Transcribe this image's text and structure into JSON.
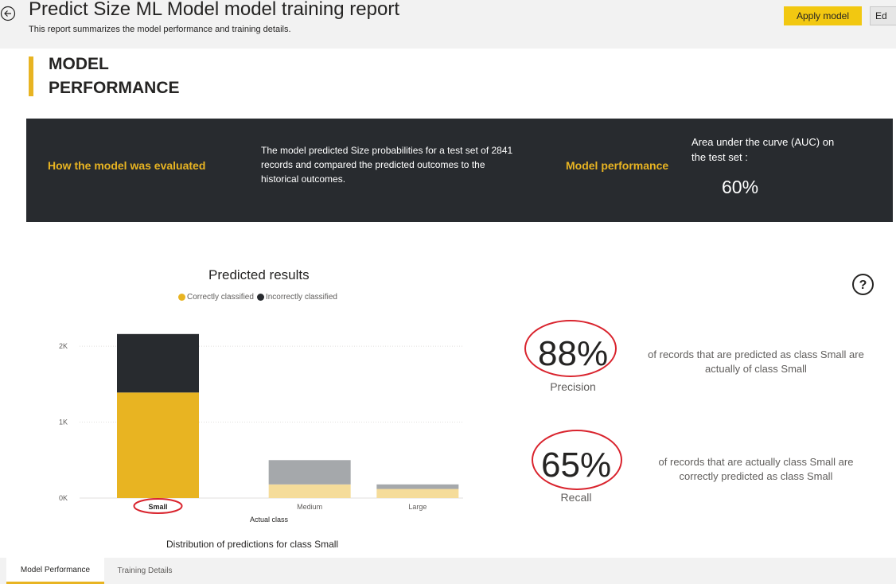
{
  "header": {
    "title": "Predict Size ML Model model training report",
    "subtitle": "This report summarizes the model performance and training details.",
    "apply_label": "Apply model",
    "edit_label": "Ed"
  },
  "section": {
    "title": "MODEL PERFORMANCE"
  },
  "evaluation": {
    "heading": "How the model was evaluated",
    "description": "The model predicted Size probabilities for a test set of 2841 records and compared the predicted outcomes to the historical outcomes.",
    "performance_heading": "Model performance",
    "auc_label": "Area under the curve (AUC) on the test set :",
    "auc_value": "60%"
  },
  "chart": {
    "footer": "Distribution of predictions for class Small"
  },
  "chart_data": {
    "type": "bar",
    "stacked": true,
    "title": "Predicted results",
    "xlabel": "Actual class",
    "ylabel": "",
    "categories": [
      "Small",
      "Medium",
      "Large"
    ],
    "highlight_category": "Small",
    "ylim": [
      0,
      2200
    ],
    "yticks": [
      0,
      1000,
      2000
    ],
    "ytick_labels": [
      "0K",
      "1K",
      "2K"
    ],
    "grid": true,
    "legend_position": "top",
    "series": [
      {
        "name": "Correctly classified",
        "values": [
          1390,
          180,
          120
        ],
        "color": "#e8b422",
        "muted_color": "#f5dc9a"
      },
      {
        "name": "Incorrectly classified",
        "values": [
          770,
          320,
          60
        ],
        "color": "#282b2f",
        "muted_color": "#a5a8ab"
      }
    ]
  },
  "metrics": {
    "precision": {
      "value": "88%",
      "label": "Precision",
      "description": "of records that are predicted as class Small are actually of class Small"
    },
    "recall": {
      "value": "65%",
      "label": "Recall",
      "description": "of records that are actually class Small are correctly predicted as class Small"
    }
  },
  "tabs": [
    {
      "label": "Model Performance",
      "active": true
    },
    {
      "label": "Training Details",
      "active": false
    }
  ],
  "colors": {
    "accent": "#e8b422",
    "dark": "#282b2f",
    "annotation_ring": "#d9232d"
  }
}
